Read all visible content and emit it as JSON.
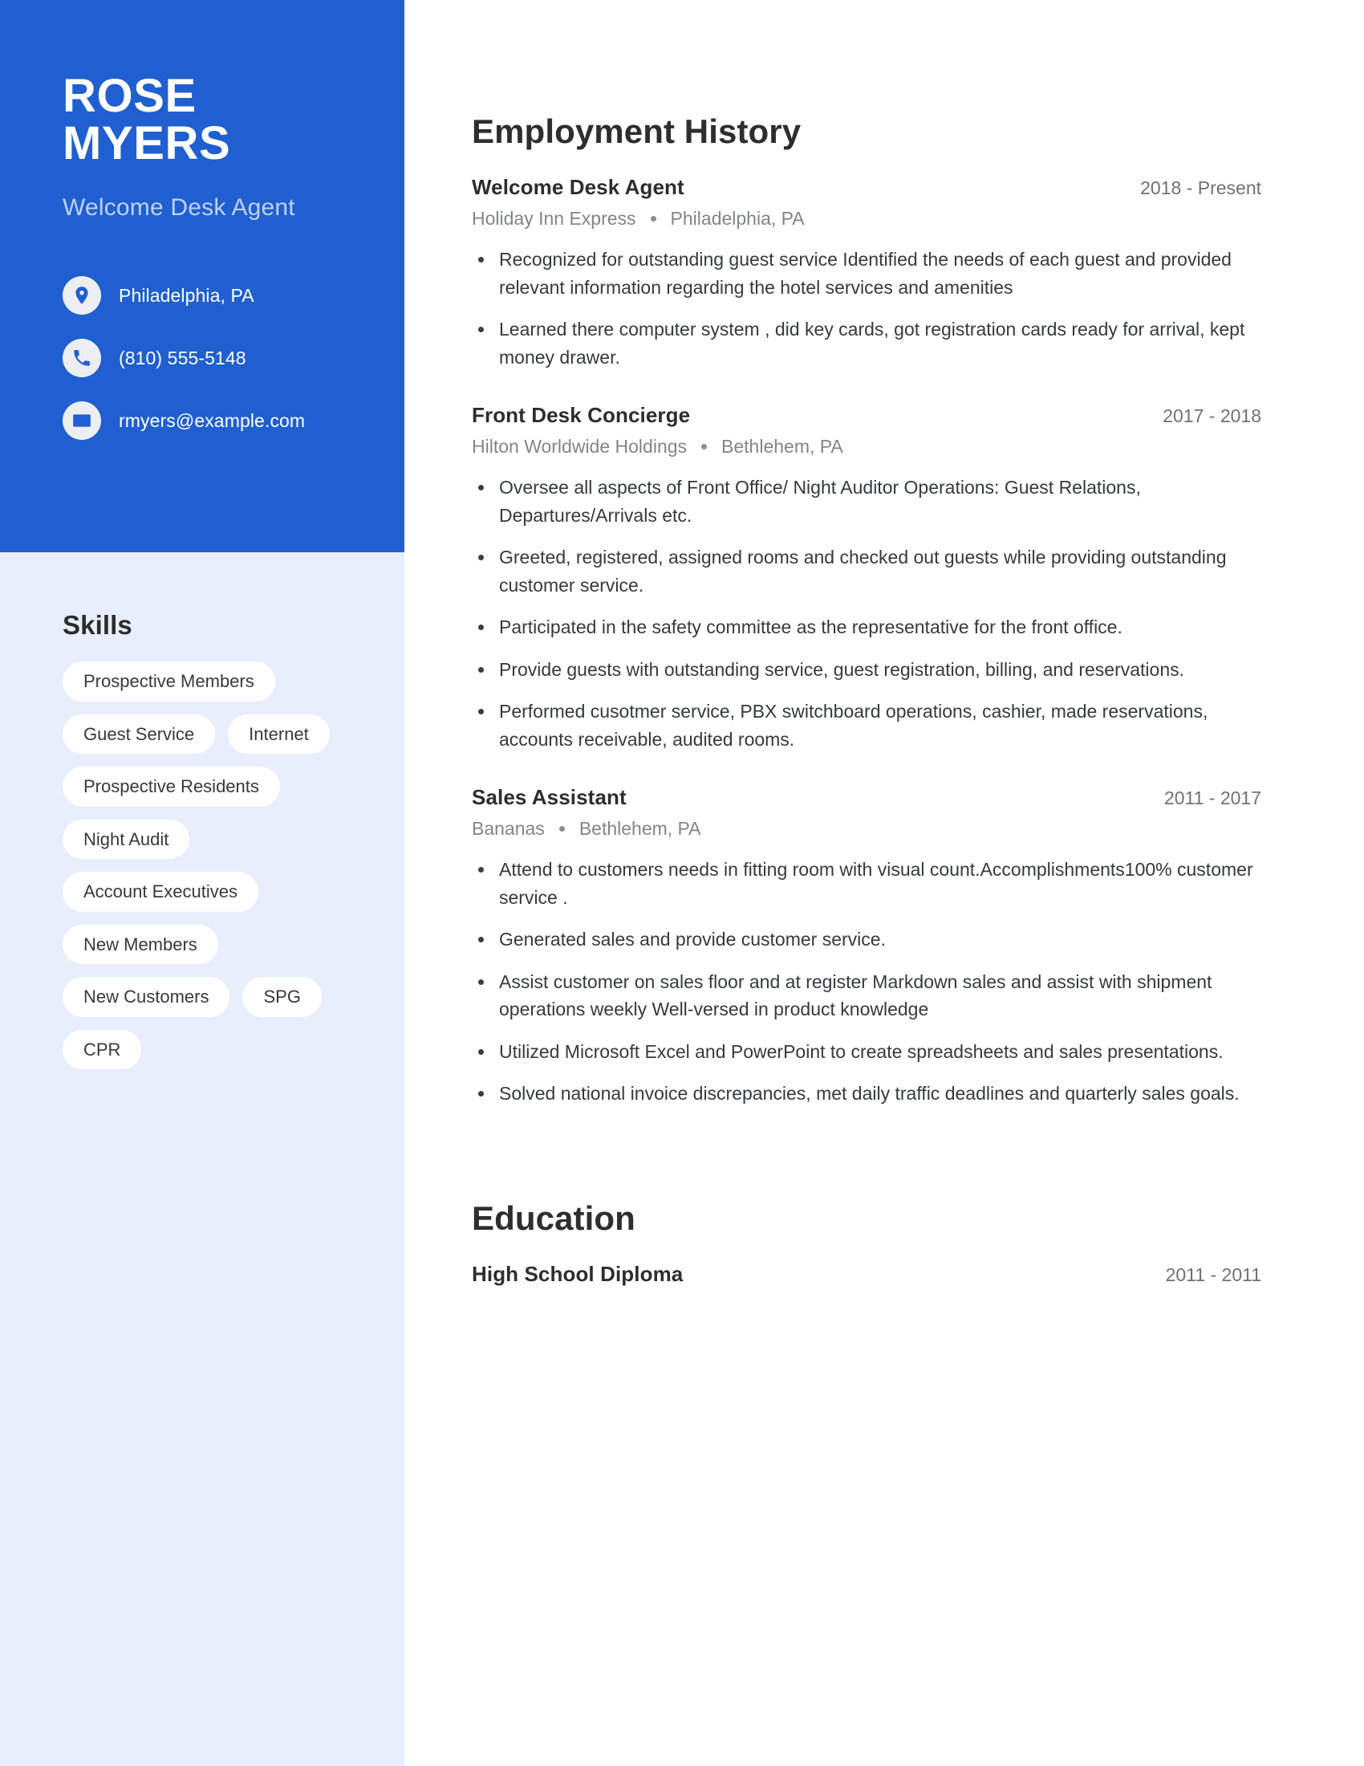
{
  "theme": {
    "primary_blue": "#1f5fd0",
    "sidebar_bg": "#e8eefb",
    "tag_bg": "#ffffff",
    "subtitle_color": "#c0d0f2"
  },
  "header": {
    "first_name": "ROSE",
    "last_name": "MYERS",
    "job_title": "Welcome Desk Agent"
  },
  "contact": {
    "items": [
      {
        "icon": "location-pin-icon",
        "value": "Philadelphia, PA"
      },
      {
        "icon": "phone-icon",
        "value": "(810) 555-5148"
      },
      {
        "icon": "envelope-icon",
        "value": "rmyers@example.com"
      }
    ]
  },
  "skills": {
    "heading": "Skills",
    "rows": [
      [
        "Prospective Members"
      ],
      [
        "Guest Service",
        "Internet"
      ],
      [
        "Prospective Residents"
      ],
      [
        "Night Audit"
      ],
      [
        "Account Executives"
      ],
      [
        "New Members"
      ],
      [
        "New Customers",
        "SPG"
      ],
      [
        "CPR"
      ]
    ]
  },
  "employment": {
    "heading": "Employment History",
    "entries": [
      {
        "title": "Welcome Desk Agent",
        "dates": "2018 - Present",
        "company": "Holiday Inn Express",
        "location": "Philadelphia, PA",
        "bullets": [
          "Recognized for outstanding guest service Identified the needs of each guest and provided relevant information regarding the hotel services and amenities",
          "Learned there computer system , did key cards, got registration cards ready for arrival, kept money drawer."
        ]
      },
      {
        "title": "Front Desk Concierge",
        "dates": "2017 - 2018",
        "company": "Hilton Worldwide Holdings",
        "location": "Bethlehem, PA",
        "bullets": [
          "Oversee all aspects of Front Office/ Night Auditor Operations: Guest Relations, Departures/Arrivals etc.",
          "Greeted, registered, assigned rooms and checked out guests while providing outstanding customer service.",
          "Participated in the safety committee as the representative for the front office.",
          "Provide guests with outstanding service, guest registration, billing, and reservations.",
          "Performed cusotmer service, PBX switchboard operations, cashier, made reservations, accounts receivable, audited rooms."
        ]
      },
      {
        "title": "Sales Assistant",
        "dates": "2011 - 2017",
        "company": "Bananas",
        "location": "Bethlehem, PA",
        "bullets": [
          "Attend to customers needs in fitting room with visual count.Accomplishments100% customer service .",
          "Generated sales and provide customer service.",
          "Assist customer on sales floor and at register Markdown sales and assist with shipment operations weekly Well-versed in product knowledge",
          "Utilized Microsoft Excel and PowerPoint to create spreadsheets and sales presentations.",
          "Solved national invoice discrepancies, met daily traffic deadlines and quarterly sales goals."
        ]
      }
    ]
  },
  "education": {
    "heading": "Education",
    "entries": [
      {
        "title": "High School Diploma",
        "dates": "2011 - 2011"
      }
    ]
  }
}
